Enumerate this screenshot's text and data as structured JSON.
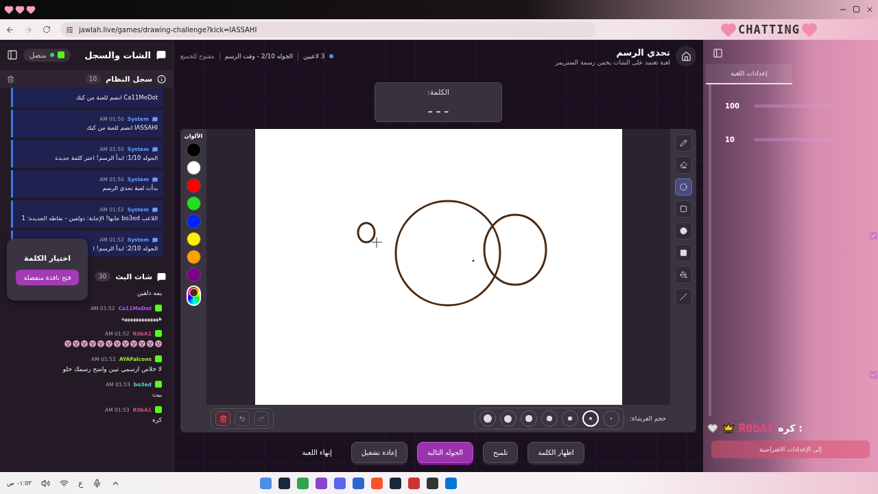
{
  "browser": {
    "url": "jawlah.live/games/drawing-challenge?kick=IASSAHI"
  },
  "overlay": {
    "banner": "CHATTING",
    "guess_text": "كره :",
    "guess_user": "R0bA1"
  },
  "sidebar": {
    "title": "الشات والسجل",
    "status": "متصل",
    "connected": true,
    "system_log": {
      "title": "سجل النظام",
      "count": "10",
      "entries": [
        {
          "text": "Ca11MeDot انضم للعبة من كيك"
        },
        {
          "time": "AM 01:50",
          "sender": "System",
          "text": "IASSAHI انضم للعبة من كيك"
        },
        {
          "time": "AM 01:50",
          "sender": "System",
          "text": "الجوله 1/10: ابدأ الرسم! اختر كلمة جديدة"
        },
        {
          "time": "AM 01:50",
          "sender": "System",
          "text": "بدأت لعبة تحدي الرسم"
        },
        {
          "time": "AM 01:52",
          "sender": "System",
          "text": "اللاعب bo3ed جابها! الإجابة: دولفين - نقاطه الجديدة: 1"
        },
        {
          "time": "AM 01:52",
          "sender": "System",
          "text": "الجوله 2/10: ابدأ الرسم! ا"
        }
      ]
    },
    "stream_chat": {
      "title": "شات البث",
      "count": "30",
      "messages": [
        {
          "kind": "text",
          "text": "يمه دلفين"
        },
        {
          "kind": "text",
          "time": "AM 01:52",
          "user": "Ca11MeDot",
          "color": "#b05cf0",
          "text": "هههههههههههههه"
        },
        {
          "kind": "emoji",
          "time": "AM 01:52",
          "user": "R0bA1",
          "color": "#e2487c",
          "emojis": [
            {
              "kind": "face"
            },
            {
              "kind": "face"
            },
            {
              "kind": "face"
            },
            {
              "kind": "face"
            },
            {
              "kind": "face"
            },
            {
              "kind": "face"
            },
            {
              "kind": "face"
            },
            {
              "kind": "face"
            },
            {
              "kind": "face"
            },
            {
              "kind": "face"
            },
            {
              "kind": "face"
            },
            {
              "kind": "face"
            }
          ]
        },
        {
          "kind": "text",
          "time": "AM 01:52",
          "user": "AYAFalcons",
          "color": "#a6e83a",
          "text": "لا خلاص ارسمي تبين واضح رسمك حلو"
        },
        {
          "kind": "text",
          "time": "AM 01:53",
          "user": "bo3ed",
          "color": "#5ed6d0",
          "text": "بيت"
        },
        {
          "kind": "text",
          "time": "AM 01:53",
          "user": "R0bA1",
          "color": "#e2487c",
          "text": "كره"
        }
      ]
    }
  },
  "popup": {
    "title": "اختيار الكلمة",
    "button": "فتح نافذة منفصلة"
  },
  "game": {
    "title": "تحدي الرسم",
    "subtitle": "لعبة تعتمد على الشات يخمن رسمة الستريمر",
    "players": "3 لاعبين",
    "round": "الجوله 2/10 - وقت الرسم",
    "access": "مفتوح للجميع",
    "word_label": "الكلمة:",
    "word": "– – –",
    "colors_label": "الألوان",
    "colors": [
      {
        "kind": "swatch",
        "color": "#000000",
        "selected": false
      },
      {
        "kind": "swatch",
        "color": "#ffffff",
        "selected": false
      },
      {
        "kind": "swatch",
        "color": "#ff0000",
        "selected": false
      },
      {
        "kind": "swatch",
        "color": "#22e022",
        "selected": false
      },
      {
        "kind": "swatch",
        "color": "#0022ff",
        "selected": false
      },
      {
        "kind": "swatch",
        "color": "#ffee00",
        "selected": false
      },
      {
        "kind": "swatch",
        "color": "#ffa000",
        "selected": false
      },
      {
        "kind": "swatch",
        "color": "#80008a",
        "selected": false
      },
      {
        "kind": "custom",
        "color": "#4a2a12",
        "selected": true
      }
    ],
    "tools": [
      {
        "kind": "pencil",
        "selected": false
      },
      {
        "kind": "eraser",
        "selected": false
      },
      {
        "kind": "circle",
        "selected": true
      },
      {
        "kind": "rect",
        "selected": false
      },
      {
        "kind": "filled-circle",
        "selected": false
      },
      {
        "kind": "filled-rect",
        "selected": false
      },
      {
        "kind": "fill",
        "selected": false
      },
      {
        "kind": "line",
        "selected": false
      }
    ],
    "brush_label": "حجم الفرشاة:",
    "brush_sizes": [
      {
        "selected": false
      },
      {
        "selected": true
      },
      {
        "selected": false
      },
      {
        "selected": false
      },
      {
        "selected": false
      },
      {
        "selected": false
      },
      {
        "selected": false
      }
    ]
  },
  "actions": [
    {
      "label": "اظهار الكلمة",
      "kind": "secondary"
    },
    {
      "label": "تلميح",
      "kind": "secondary"
    },
    {
      "label": "الجوله التالية",
      "kind": "primary"
    },
    {
      "label": "إعادة تشغيل",
      "kind": "secondary"
    },
    {
      "label": "إنهاء اللعبة",
      "kind": "plain"
    }
  ],
  "settings": {
    "tab": {
      "label": "إعدادات اللعبة",
      "selected": true
    },
    "sliders": [
      {
        "value": "100",
        "level": 1
      },
      {
        "value": "10",
        "level": 1
      }
    ],
    "checks": [
      {
        "checked": true
      },
      {
        "checked": true
      }
    ],
    "reset": "إلى الإعدادات الافتراضية"
  },
  "taskbar": {
    "time": "٠١:٥٣ ص",
    "language": "ع"
  }
}
